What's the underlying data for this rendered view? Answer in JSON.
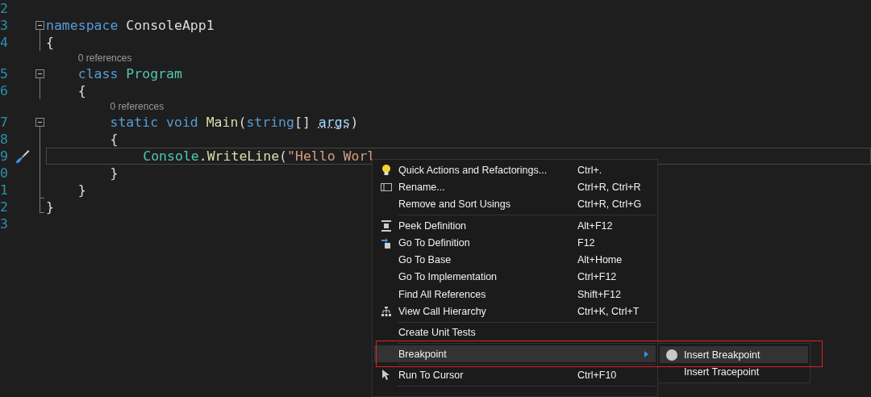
{
  "editor": {
    "lines": [
      {
        "number": "2",
        "collapsible": false,
        "current": false
      },
      {
        "number": "3",
        "collapsible": true,
        "current": false,
        "tokens": [
          {
            "text": "namespace",
            "kind": "keyword"
          },
          {
            "text": " ConsoleApp1",
            "kind": "plain"
          }
        ]
      },
      {
        "number": "4",
        "collapsible": false,
        "current": false,
        "tokens": [
          {
            "text": "{",
            "kind": "plain"
          }
        ]
      },
      {
        "number": "5",
        "collapsible": true,
        "current": false,
        "codelens": "0 references",
        "tokens": [
          {
            "text": "    class ",
            "kind": "keyword"
          },
          {
            "text": "Program",
            "kind": "type"
          }
        ]
      },
      {
        "number": "6",
        "collapsible": false,
        "current": false,
        "tokens": [
          {
            "text": "    {",
            "kind": "plain"
          }
        ]
      },
      {
        "number": "7",
        "collapsible": true,
        "current": false,
        "codelens": "0 references",
        "tokens": [
          {
            "text": "        static void ",
            "kind": "keyword"
          },
          {
            "text": "Main",
            "kind": "method"
          },
          {
            "text": "(",
            "kind": "plain"
          },
          {
            "text": "string",
            "kind": "keyword"
          },
          {
            "text": "[] ",
            "kind": "plain"
          },
          {
            "text": "args",
            "kind": "param",
            "suggestion": true
          },
          {
            "text": ")",
            "kind": "plain"
          }
        ]
      },
      {
        "number": "8",
        "collapsible": false,
        "current": false,
        "tokens": [
          {
            "text": "        {",
            "kind": "plain"
          }
        ]
      },
      {
        "number": "9",
        "collapsible": false,
        "current": true,
        "tokens": [
          {
            "text": "            Console",
            "kind": "type"
          },
          {
            "text": ".",
            "kind": "plain"
          },
          {
            "text": "WriteLine",
            "kind": "method"
          },
          {
            "text": "(",
            "kind": "plain"
          },
          {
            "text": "\"Hello Worl",
            "kind": "string"
          }
        ]
      },
      {
        "number": "0",
        "collapsible": false,
        "current": false,
        "tokens": [
          {
            "text": "        }",
            "kind": "plain"
          }
        ]
      },
      {
        "number": "1",
        "collapsible": false,
        "current": false,
        "tokens": [
          {
            "text": "    }",
            "kind": "plain"
          }
        ]
      },
      {
        "number": "2",
        "collapsible": false,
        "current": false,
        "tokens": [
          {
            "text": "}",
            "kind": "plain"
          }
        ]
      },
      {
        "number": "3",
        "collapsible": false,
        "current": false
      }
    ]
  },
  "context_menu": {
    "items": [
      {
        "kind": "item",
        "label": "Quick Actions and Refactorings...",
        "shortcut": "Ctrl+.",
        "selected": false
      },
      {
        "kind": "item",
        "label": "Rename...",
        "shortcut": "Ctrl+R, Ctrl+R",
        "selected": false
      },
      {
        "kind": "item",
        "label": "Remove and Sort Usings",
        "shortcut": "Ctrl+R, Ctrl+G",
        "selected": false
      },
      {
        "kind": "separator"
      },
      {
        "kind": "item",
        "label": "Peek Definition",
        "shortcut": "Alt+F12",
        "selected": false
      },
      {
        "kind": "item",
        "label": "Go To Definition",
        "shortcut": "F12",
        "selected": false
      },
      {
        "kind": "item",
        "label": "Go To Base",
        "shortcut": "Alt+Home",
        "selected": false
      },
      {
        "kind": "item",
        "label": "Go To Implementation",
        "shortcut": "Ctrl+F12",
        "selected": false
      },
      {
        "kind": "item",
        "label": "Find All References",
        "shortcut": "Shift+F12",
        "selected": false
      },
      {
        "kind": "item",
        "label": "View Call Hierarchy",
        "shortcut": "Ctrl+K, Ctrl+T",
        "selected": false
      },
      {
        "kind": "separator"
      },
      {
        "kind": "item",
        "label": "Create Unit Tests",
        "selected": false
      },
      {
        "kind": "separator"
      },
      {
        "kind": "submenu",
        "label": "Breakpoint",
        "selected": true
      },
      {
        "kind": "separator"
      },
      {
        "kind": "item",
        "label": "Run To Cursor",
        "shortcut": "Ctrl+F10",
        "selected": false
      },
      {
        "kind": "separator"
      }
    ]
  },
  "submenu": {
    "items": [
      {
        "label": "Insert Breakpoint",
        "selected": true
      },
      {
        "label": "Insert Tracepoint",
        "selected": false
      }
    ]
  }
}
